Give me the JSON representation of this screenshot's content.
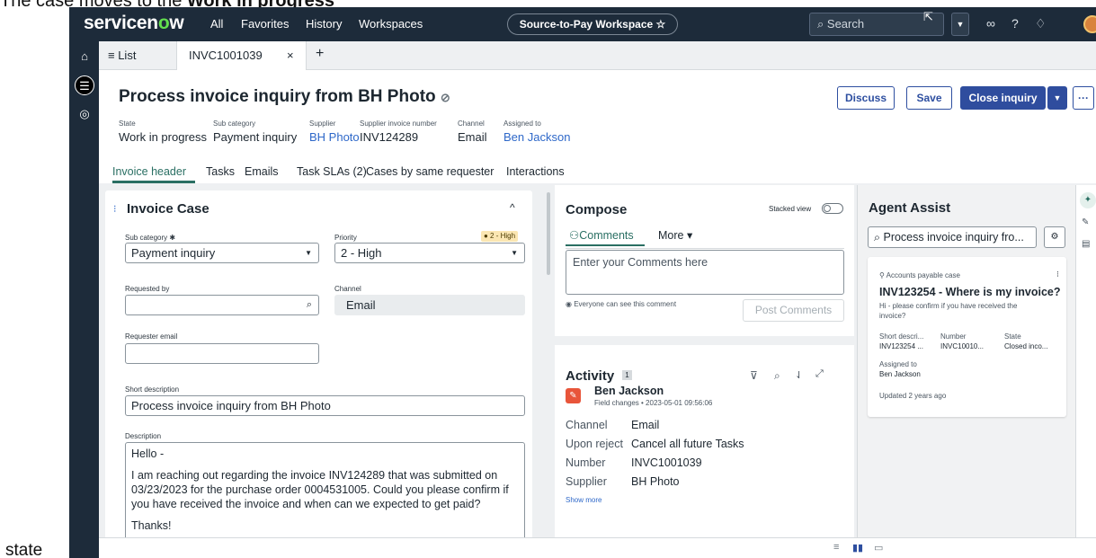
{
  "caption": {
    "top_prefix": "The case moves to the ",
    "top_bold": "Work in progress",
    "bottom": "state"
  },
  "topnav": {
    "logo_a": "servicen",
    "logo_o": "o",
    "logo_b": "w",
    "links": [
      "All",
      "Favorites",
      "History",
      "Workspaces"
    ],
    "workspace": "Source-to-Pay Workspace ☆",
    "search_placeholder": "Search",
    "brand_color": "#1d2b3a",
    "accent_color": "#63df4e"
  },
  "tabs": {
    "list": "≡ List",
    "record": "INVC1001039",
    "close": "×",
    "add": "+"
  },
  "record": {
    "title": "Process invoice inquiry from BH Photo",
    "meta": [
      {
        "label": "State",
        "value": "Work in progress"
      },
      {
        "label": "Sub category",
        "value": "Payment inquiry"
      },
      {
        "label": "Supplier",
        "value": "BH Photo"
      },
      {
        "label": "Supplier invoice number",
        "value": "INV124289"
      },
      {
        "label": "Channel",
        "value": "Email"
      },
      {
        "label": "Assigned to",
        "value": "Ben Jackson"
      }
    ],
    "buttons": {
      "discuss": "Discuss",
      "save": "Save",
      "close_inquiry": "Close inquiry",
      "more": "···"
    }
  },
  "subtabs": [
    "Invoice header",
    "Tasks",
    "Emails",
    "Task SLAs (2)",
    "Cases by same requester",
    "Interactions"
  ],
  "form": {
    "heading": "Invoice Case",
    "sub_category_label": "Sub category ✱",
    "sub_category_value": "Payment inquiry",
    "priority_label": "Priority",
    "priority_badge": "● 2 - High",
    "priority_value": "2 - High",
    "requested_by_label": "Requested by",
    "requested_by_value": "",
    "channel_label": "Channel",
    "channel_value": "Email",
    "requester_email_label": "Requester email",
    "requester_email_value": "",
    "short_desc_label": "Short description",
    "short_desc_value": "Process invoice inquiry from BH Photo",
    "description_label": "Description",
    "description_lines": [
      "Hello -",
      "",
      "I am reaching out regarding the invoice INV124289 that was submitted on",
      "03/23/2023 for the purchase order 0004531005. Could you please confirm if",
      "you have received the invoice and when can we expected to get paid?",
      "",
      "Thanks!"
    ]
  },
  "compose": {
    "heading": "Compose",
    "stacked_view": "Stacked view",
    "tab_comments": "Comments",
    "tab_more": "More ▾",
    "placeholder": "Enter your Comments here",
    "visibility": "Everyone can see this comment",
    "post_button": "Post Comments"
  },
  "activity": {
    "heading": "Activity",
    "count": "1",
    "author": "Ben Jackson",
    "subline": "Field changes • 2023-05-01 09:56:06",
    "fields": [
      {
        "label": "Channel",
        "value": "Email"
      },
      {
        "label": "Upon reject",
        "value": "Cancel all future Tasks"
      },
      {
        "label": "Number",
        "value": "INVC1001039"
      },
      {
        "label": "Supplier",
        "value": "BH Photo"
      }
    ],
    "show_more": "Show more"
  },
  "agent_assist": {
    "heading": "Agent Assist",
    "search_value": "Process invoice inquiry fro...",
    "card_tag": "Accounts payable case",
    "card_title": "INV123254 - Where is my invoice?",
    "card_desc_1": "Hi - please confirm if you have received the",
    "card_desc_2": "invoice?",
    "col_labels": [
      "Short descri...",
      "Number",
      "State"
    ],
    "col_values": [
      "INV123254 ...",
      "INVC10010...",
      "Closed inco..."
    ],
    "assigned_label": "Assigned to",
    "assigned_value": "Ben Jackson",
    "updated": "Updated 2 years ago"
  }
}
